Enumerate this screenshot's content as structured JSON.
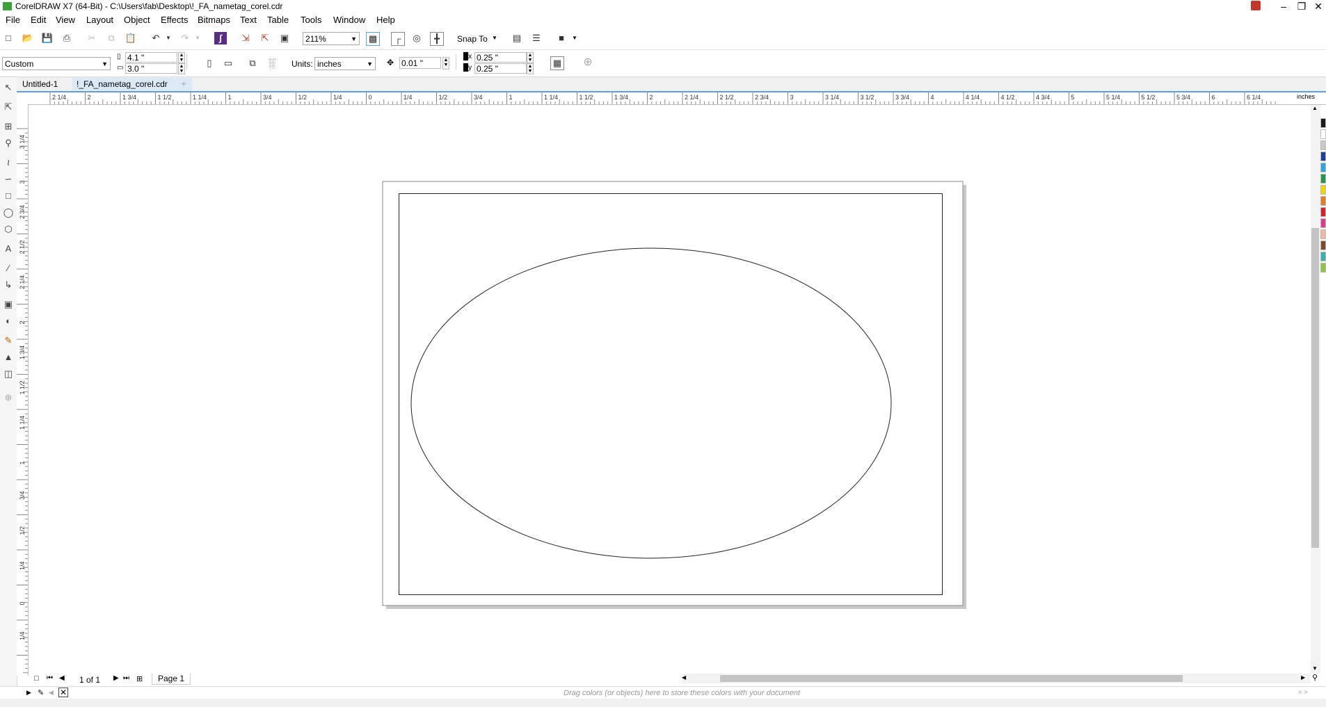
{
  "window": {
    "title": "CorelDRAW X7 (64-Bit) - C:\\Users\\fab\\Desktop\\!_FA_nametag_corel.cdr",
    "buttons": [
      "minimize",
      "restore",
      "close"
    ]
  },
  "menu": [
    "File",
    "Edit",
    "View",
    "Layout",
    "Object",
    "Effects",
    "Bitmaps",
    "Text",
    "Table",
    "Tools",
    "Window",
    "Help"
  ],
  "standard_toolbar": {
    "zoom_level": "211%",
    "snap_to_label": "Snap To"
  },
  "property_bar": {
    "page_preset": "Custom",
    "page_width": "4.1 \"",
    "page_height": "3.0 \"",
    "units_label": "Units:",
    "units_value": "inches",
    "nudge": "0.01 \"",
    "dup_x": "0.25 \"",
    "dup_y": "0.25 \""
  },
  "doc_tabs": [
    {
      "label": "Untitled-1",
      "active": false
    },
    {
      "label": "!_FA_nametag_corel.cdr",
      "active": true
    }
  ],
  "rulers": {
    "h_labels": [
      "2 1/4",
      "2",
      "1 3/4",
      "1 1/2",
      "1 1/4",
      "1",
      "3/4",
      "1/2",
      "1/4",
      "0",
      "1/4",
      "1/2",
      "3/4",
      "1",
      "1 1/4",
      "1 1/2",
      "1 3/4",
      "2",
      "2 1/4",
      "2 1/2",
      "2 3/4",
      "3",
      "3 1/4",
      "3 1/2",
      "3 3/4",
      "4",
      "4 1/4",
      "4 1/2",
      "4 3/4",
      "5",
      "5 1/4",
      "5 1/2",
      "5 3/4",
      "6",
      "6 1/4"
    ],
    "units": "inches",
    "v_labels": [
      "3 1/4",
      "3",
      "2 3/4",
      "2 1/2",
      "2 1/4",
      "2",
      "1 3/4",
      "1 1/2",
      "1 1/4",
      "1",
      "3/4",
      "1/2",
      "1/4",
      "0",
      "1/4"
    ]
  },
  "page_nav": {
    "count": "1 of 1",
    "page_tab": "Page 1"
  },
  "doc_palette": {
    "hint": "Drag colors (or objects) here to store these colors with your document"
  },
  "colors": {
    "accent": "#5aa0dc",
    "palette": [
      "#1a1a1a",
      "#ffffff",
      "#c8c8c8",
      "#1b3f9c",
      "#2aa7e0",
      "#1e9a48",
      "#f5d300",
      "#e87b1c",
      "#d81e28",
      "#e23a8a",
      "#f0b8a0",
      "#7a4a2a",
      "#3ab0a8",
      "#8fc63c"
    ]
  }
}
